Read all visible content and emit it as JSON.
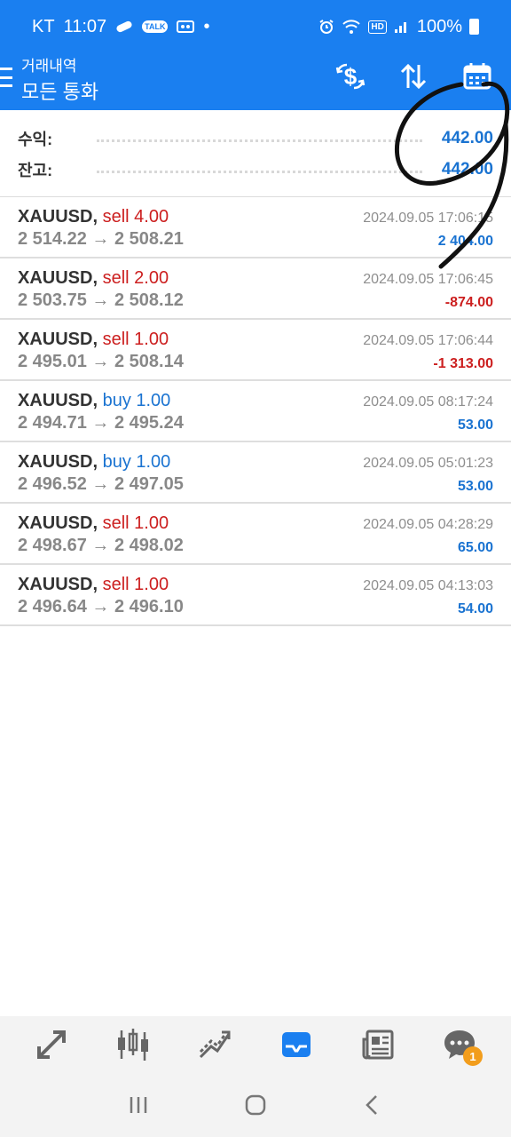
{
  "status_bar": {
    "carrier": "KT",
    "time": "11:07",
    "talk_badge": "TALK",
    "dot": "•",
    "hd": "HD",
    "battery": "100%"
  },
  "app_bar": {
    "subtitle": "거래내역",
    "title": "모든 통화"
  },
  "summary": {
    "profit_label": "수익:",
    "profit_value": "442.00",
    "balance_label": "잔고:",
    "balance_value": "442.00"
  },
  "trades": [
    {
      "symbol": "XAUUSD,",
      "side": "sell 4.00",
      "side_type": "sell",
      "prices": "2 514.22 → 2 508.21",
      "time": "2024.09.05 17:06:15",
      "profit": "2 404.00",
      "profit_type": "pos"
    },
    {
      "symbol": "XAUUSD,",
      "side": "sell 2.00",
      "side_type": "sell",
      "prices": "2 503.75 → 2 508.12",
      "time": "2024.09.05 17:06:45",
      "profit": "-874.00",
      "profit_type": "neg"
    },
    {
      "symbol": "XAUUSD,",
      "side": "sell 1.00",
      "side_type": "sell",
      "prices": "2 495.01 → 2 508.14",
      "time": "2024.09.05 17:06:44",
      "profit": "-1 313.00",
      "profit_type": "neg"
    },
    {
      "symbol": "XAUUSD,",
      "side": "buy 1.00",
      "side_type": "buy",
      "prices": "2 494.71 → 2 495.24",
      "time": "2024.09.05 08:17:24",
      "profit": "53.00",
      "profit_type": "pos"
    },
    {
      "symbol": "XAUUSD,",
      "side": "buy 1.00",
      "side_type": "buy",
      "prices": "2 496.52 → 2 497.05",
      "time": "2024.09.05 05:01:23",
      "profit": "53.00",
      "profit_type": "pos"
    },
    {
      "symbol": "XAUUSD,",
      "side": "sell 1.00",
      "side_type": "sell",
      "prices": "2 498.67 → 2 498.02",
      "time": "2024.09.05 04:28:29",
      "profit": "65.00",
      "profit_type": "pos"
    },
    {
      "symbol": "XAUUSD,",
      "side": "sell 1.00",
      "side_type": "sell",
      "prices": "2 496.64 → 2 496.10",
      "time": "2024.09.05 04:13:03",
      "profit": "54.00",
      "profit_type": "pos"
    }
  ],
  "bottom_nav": {
    "items": [
      "quotes-icon",
      "chart-icon",
      "trade-icon",
      "history-icon",
      "news-icon",
      "chat-icon"
    ],
    "active": "history-icon",
    "chat_badge": "1"
  },
  "colors": {
    "brand_blue": "#1a7ff0",
    "profit_blue": "#1a73d1",
    "loss_red": "#cc1f1f",
    "badge_orange": "#f29d1c"
  }
}
